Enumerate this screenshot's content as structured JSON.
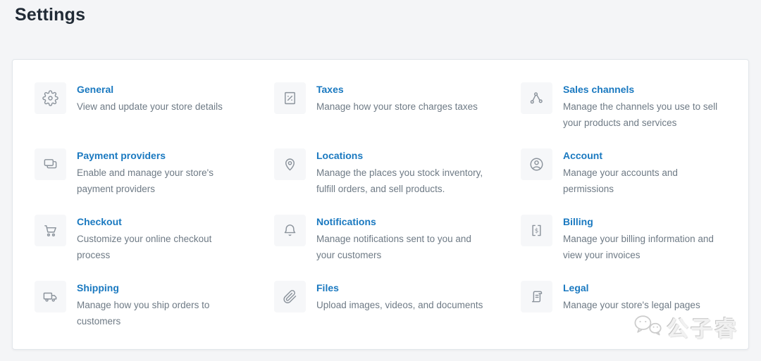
{
  "page": {
    "title": "Settings"
  },
  "colors": {
    "link_blue": "#1a79c0",
    "description_gray": "#6e7a85",
    "heading_dark": "#212b36",
    "page_bg": "#f4f5f7",
    "card_bg": "#ffffff",
    "card_border": "#e2e6ea",
    "icon_gray": "#8b939c",
    "icon_box_bg": "#f6f7f9"
  },
  "settings_grid": {
    "items": [
      {
        "icon": "gear-icon",
        "title": "General",
        "description": "View and update your store details"
      },
      {
        "icon": "taxes-percent-icon",
        "title": "Taxes",
        "description": "Manage how your store charges taxes"
      },
      {
        "icon": "sales-channels-icon",
        "title": "Sales channels",
        "description": "Manage the channels you use to sell your products and services"
      },
      {
        "icon": "payment-cards-icon",
        "title": "Payment providers",
        "description": "Enable and manage your store's payment providers"
      },
      {
        "icon": "location-pin-icon",
        "title": "Locations",
        "description": "Manage the places you stock inventory, fulfill orders, and sell products."
      },
      {
        "icon": "account-person-icon",
        "title": "Account",
        "description": "Manage your accounts and permissions"
      },
      {
        "icon": "cart-icon",
        "title": "Checkout",
        "description": "Customize your online checkout process"
      },
      {
        "icon": "bell-icon",
        "title": "Notifications",
        "description": "Manage notifications sent to you and your customers"
      },
      {
        "icon": "billing-receipt-icon",
        "title": "Billing",
        "description": "Manage your billing information and view your invoices"
      },
      {
        "icon": "truck-icon",
        "title": "Shipping",
        "description": "Manage how you ship orders to customers"
      },
      {
        "icon": "paperclip-icon",
        "title": "Files",
        "description": "Upload images, videos, and documents"
      },
      {
        "icon": "legal-scroll-icon",
        "title": "Legal",
        "description": "Manage your store's legal pages"
      }
    ]
  },
  "watermark": {
    "text": "公子睿",
    "icon": "wechat-icon"
  }
}
